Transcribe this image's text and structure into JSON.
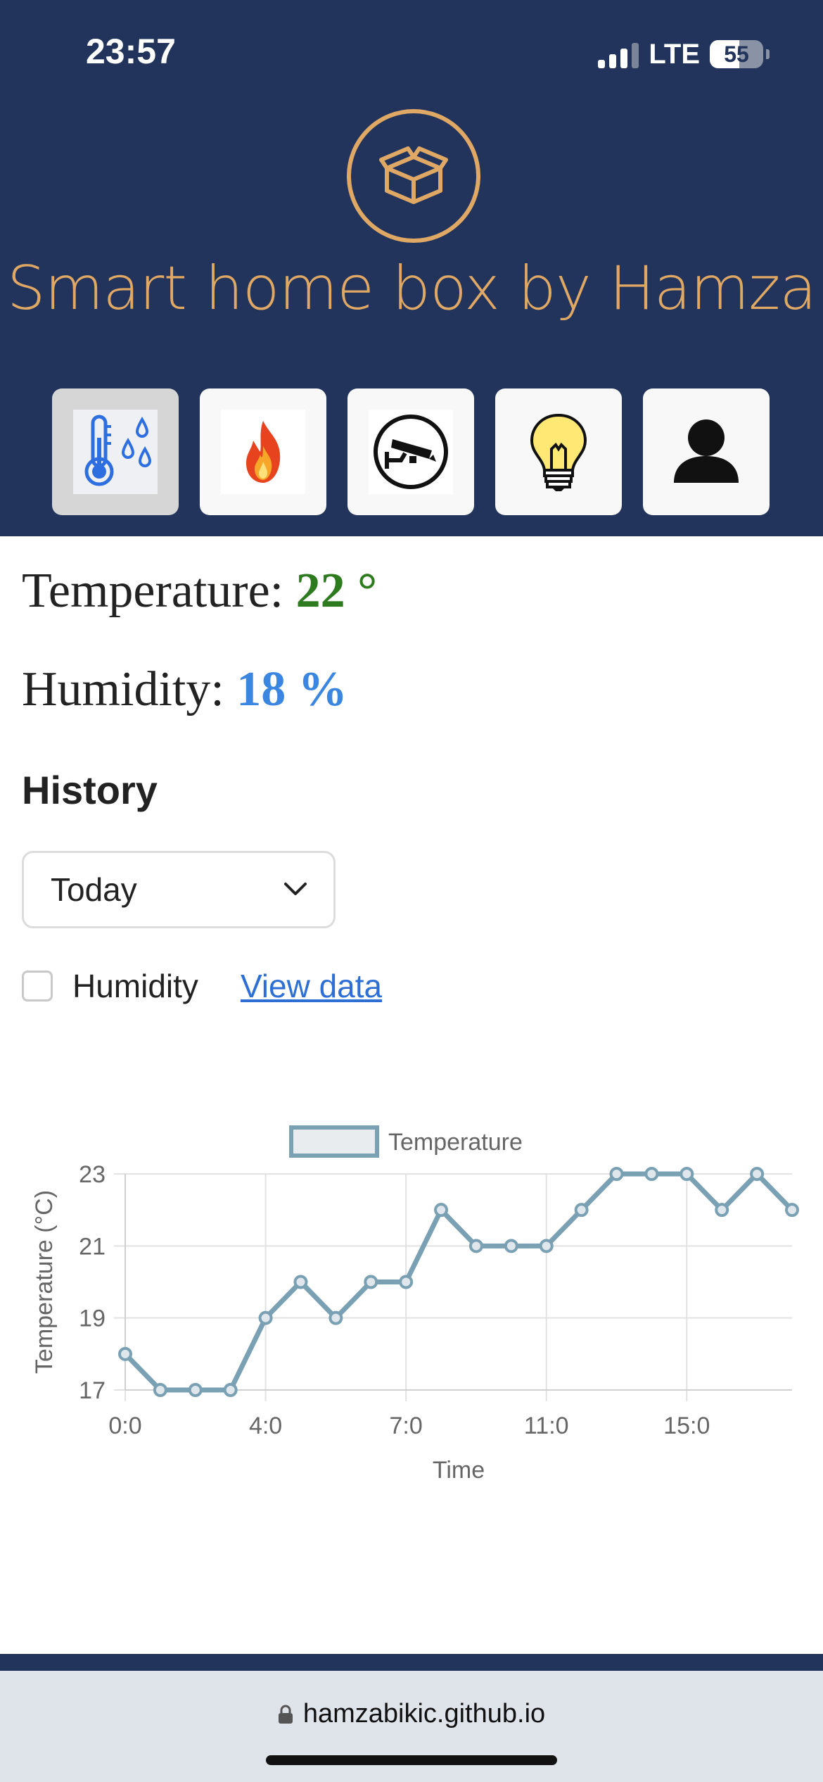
{
  "status_bar": {
    "time": "23:57",
    "network": "LTE",
    "battery": "55"
  },
  "header": {
    "title": "Smart home box by Hamza",
    "brand_color": "#e0a865",
    "background": "#22345b",
    "nav": [
      {
        "icon": "thermometer-drops-icon",
        "active": true
      },
      {
        "icon": "fire-icon",
        "active": false
      },
      {
        "icon": "security-camera-icon",
        "active": false
      },
      {
        "icon": "light-bulb-icon",
        "active": false
      },
      {
        "icon": "user-icon",
        "active": false
      }
    ]
  },
  "readings": {
    "temperature_label": "Temperature:",
    "temperature_value": "22 °",
    "humidity_label": "Humidity:",
    "humidity_value": "18 %"
  },
  "history": {
    "heading": "History",
    "range_select": "Today",
    "humidity_checkbox_label": "Humidity",
    "humidity_checked": false,
    "view_link": "View data"
  },
  "chart_data": {
    "type": "line",
    "legend": "Temperature",
    "legend_position": "top",
    "xlabel": "Time",
    "ylabel": "Temperature (°C)",
    "x_ticks": [
      "0:0",
      "4:0",
      "7:0",
      "11:0",
      "15:0"
    ],
    "y_ticks": [
      "17",
      "19",
      "21",
      "23"
    ],
    "ylim": [
      17,
      23
    ],
    "grid": true,
    "line_color": "#7aa0b4",
    "series": [
      {
        "name": "Temperature",
        "values": [
          18,
          17,
          17,
          17,
          19,
          20,
          19,
          20,
          20,
          22,
          21,
          21,
          21,
          22,
          23,
          23,
          23,
          22,
          23,
          22
        ]
      }
    ]
  },
  "browser": {
    "url": "hamzabikic.github.io"
  }
}
